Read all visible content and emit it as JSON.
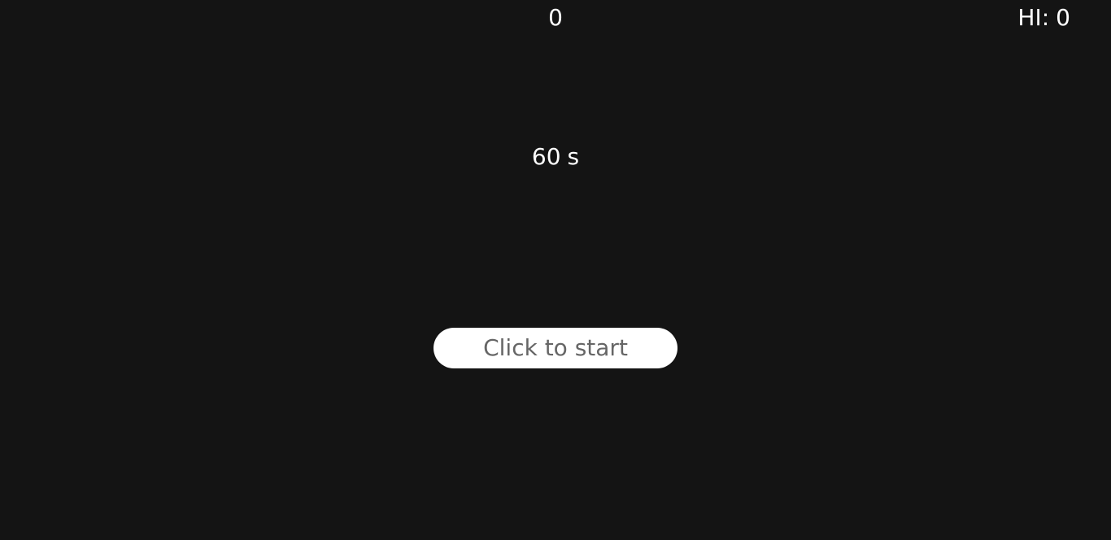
{
  "hud": {
    "score": "0",
    "hiscore_label": "HI:",
    "hiscore_value": "0"
  },
  "timer": {
    "value": "60",
    "unit": "s"
  },
  "start_button": {
    "label": "Click to start"
  },
  "colors": {
    "background": "#141414",
    "text": "#ffffff",
    "button_bg": "#ffffff",
    "button_text": "#666666"
  }
}
